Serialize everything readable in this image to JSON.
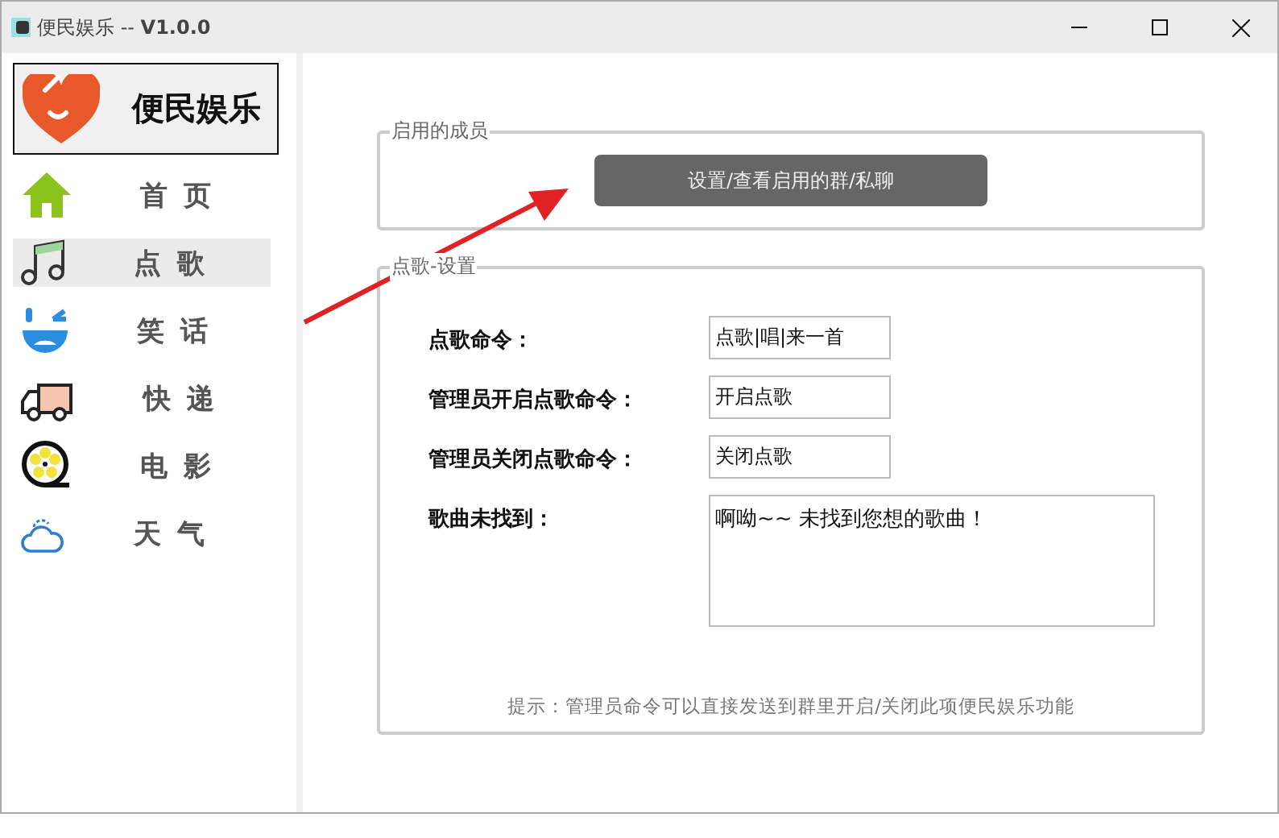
{
  "window": {
    "title": "便民娱乐 -- **V1.0.0**"
  },
  "sidebar": {
    "logo_text": "便民娱乐",
    "items": [
      {
        "kind": "home",
        "label": "首 页",
        "selected": false
      },
      {
        "kind": "music",
        "label": "点 歌",
        "selected": true
      },
      {
        "kind": "joke",
        "label": "笑 话",
        "selected": false
      },
      {
        "kind": "truck",
        "label": "快 递",
        "selected": false
      },
      {
        "kind": "film",
        "label": "电 影",
        "selected": false
      },
      {
        "kind": "weather",
        "label": "天 气",
        "selected": false
      }
    ]
  },
  "members_group": {
    "legend": "启用的成员",
    "button": "设置/查看启用的群/私聊"
  },
  "settings_group": {
    "legend": "点歌-设置",
    "fields": [
      {
        "kind": "input",
        "label": "点歌命令：",
        "value": "点歌|唱|来一首"
      },
      {
        "kind": "input",
        "label": "管理员开启点歌命令：",
        "value": "开启点歌"
      },
      {
        "kind": "input",
        "label": "管理员关闭点歌命令：",
        "value": "关闭点歌"
      },
      {
        "kind": "textarea",
        "label": "歌曲未找到：",
        "value": "啊呦~~ 未找到您想的歌曲！"
      }
    ],
    "hint": "提示：管理员命令可以直接发送到群里开启/关闭此项便民娱乐功能"
  }
}
